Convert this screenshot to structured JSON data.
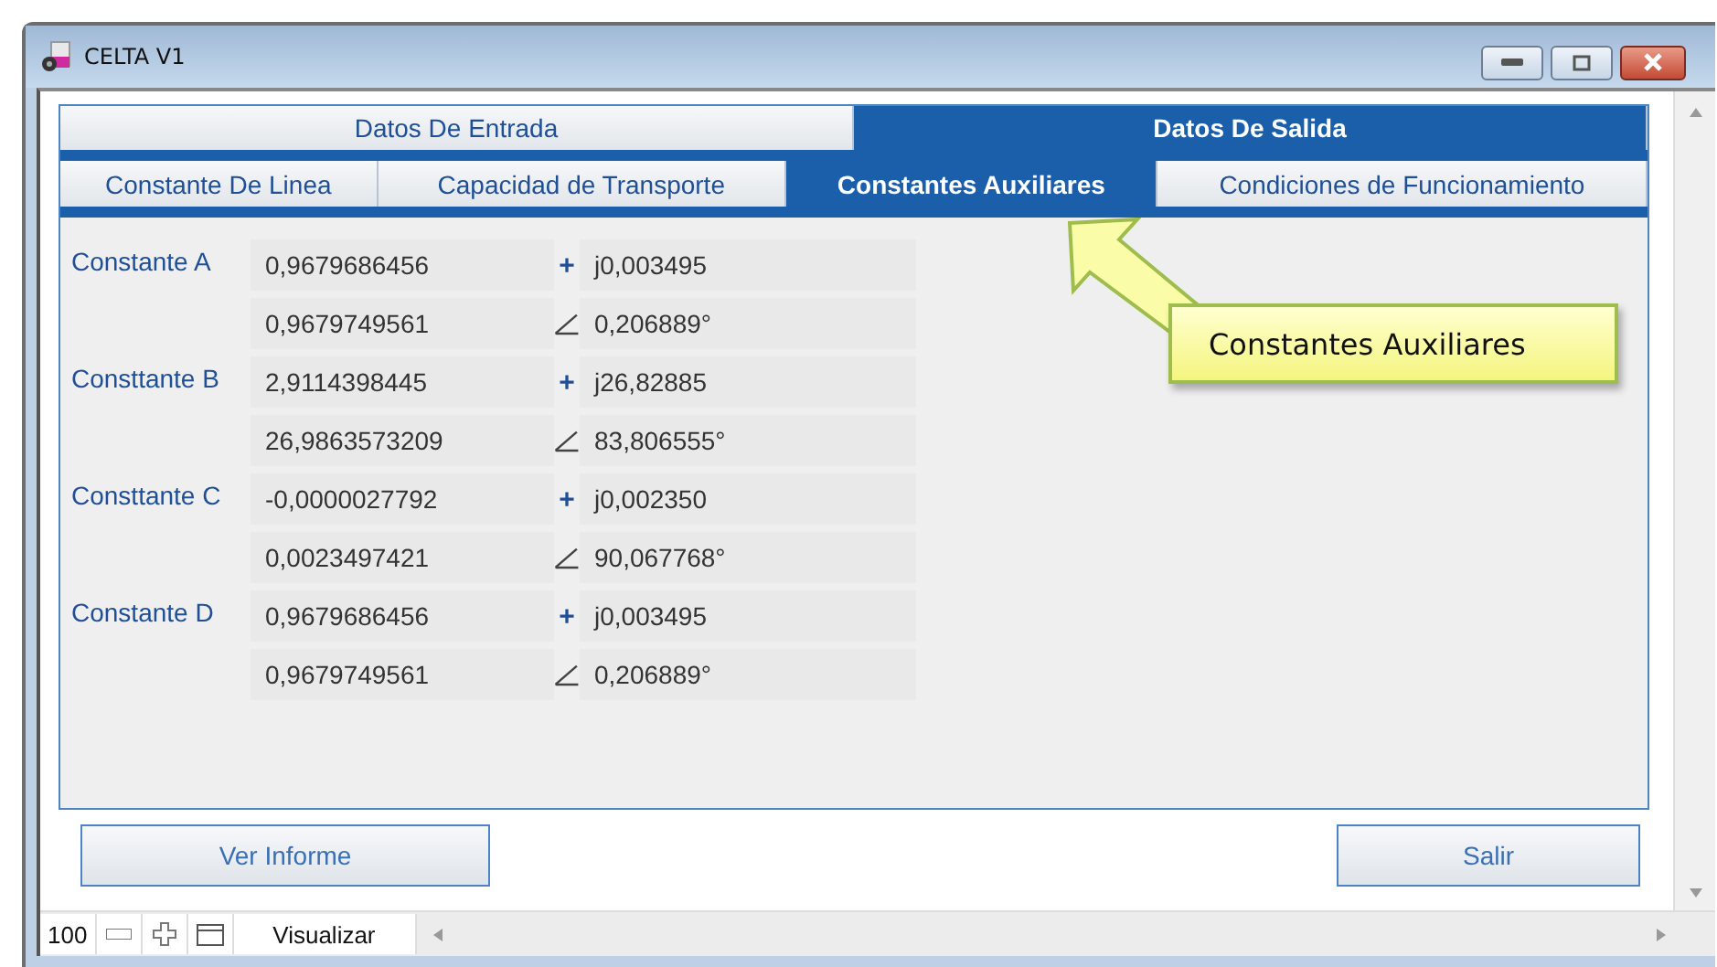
{
  "window": {
    "title": "CELTA V1"
  },
  "main_tabs": [
    {
      "label": "Datos De Entrada",
      "selected": false
    },
    {
      "label": "Datos De Salida",
      "selected": true
    }
  ],
  "sub_tabs": [
    {
      "label": "Constante De Linea",
      "selected": false
    },
    {
      "label": "Capacidad de Transporte",
      "selected": false
    },
    {
      "label": "Constantes Auxiliares",
      "selected": true
    },
    {
      "label": "Condiciones de Funcionamiento",
      "selected": false
    }
  ],
  "constants": [
    {
      "label": "Constante A",
      "real": "0,9679686456",
      "sign": "+",
      "imaginary": "j0,003495",
      "magnitude": "0,9679749561",
      "angle": "0,206889°"
    },
    {
      "label": "Consttante B",
      "real": "2,9114398445",
      "sign": "+",
      "imaginary": "j26,82885",
      "magnitude": "26,9863573209",
      "angle": "83,806555°"
    },
    {
      "label": "Consttante C",
      "real": "-0,0000027792",
      "sign": "+",
      "imaginary": "j0,002350",
      "magnitude": "0,0023497421",
      "angle": "90,067768°"
    },
    {
      "label": "Constante D",
      "real": "0,9679686456",
      "sign": "+",
      "imaginary": "j0,003495",
      "magnitude": "0,9679749561",
      "angle": "0,206889°"
    }
  ],
  "callout": {
    "text": "Constantes Auxiliares"
  },
  "buttons": [
    "Ver Informe",
    "Salir"
  ],
  "status_bar": {
    "zoom": "100",
    "mode": "Visualizar"
  }
}
